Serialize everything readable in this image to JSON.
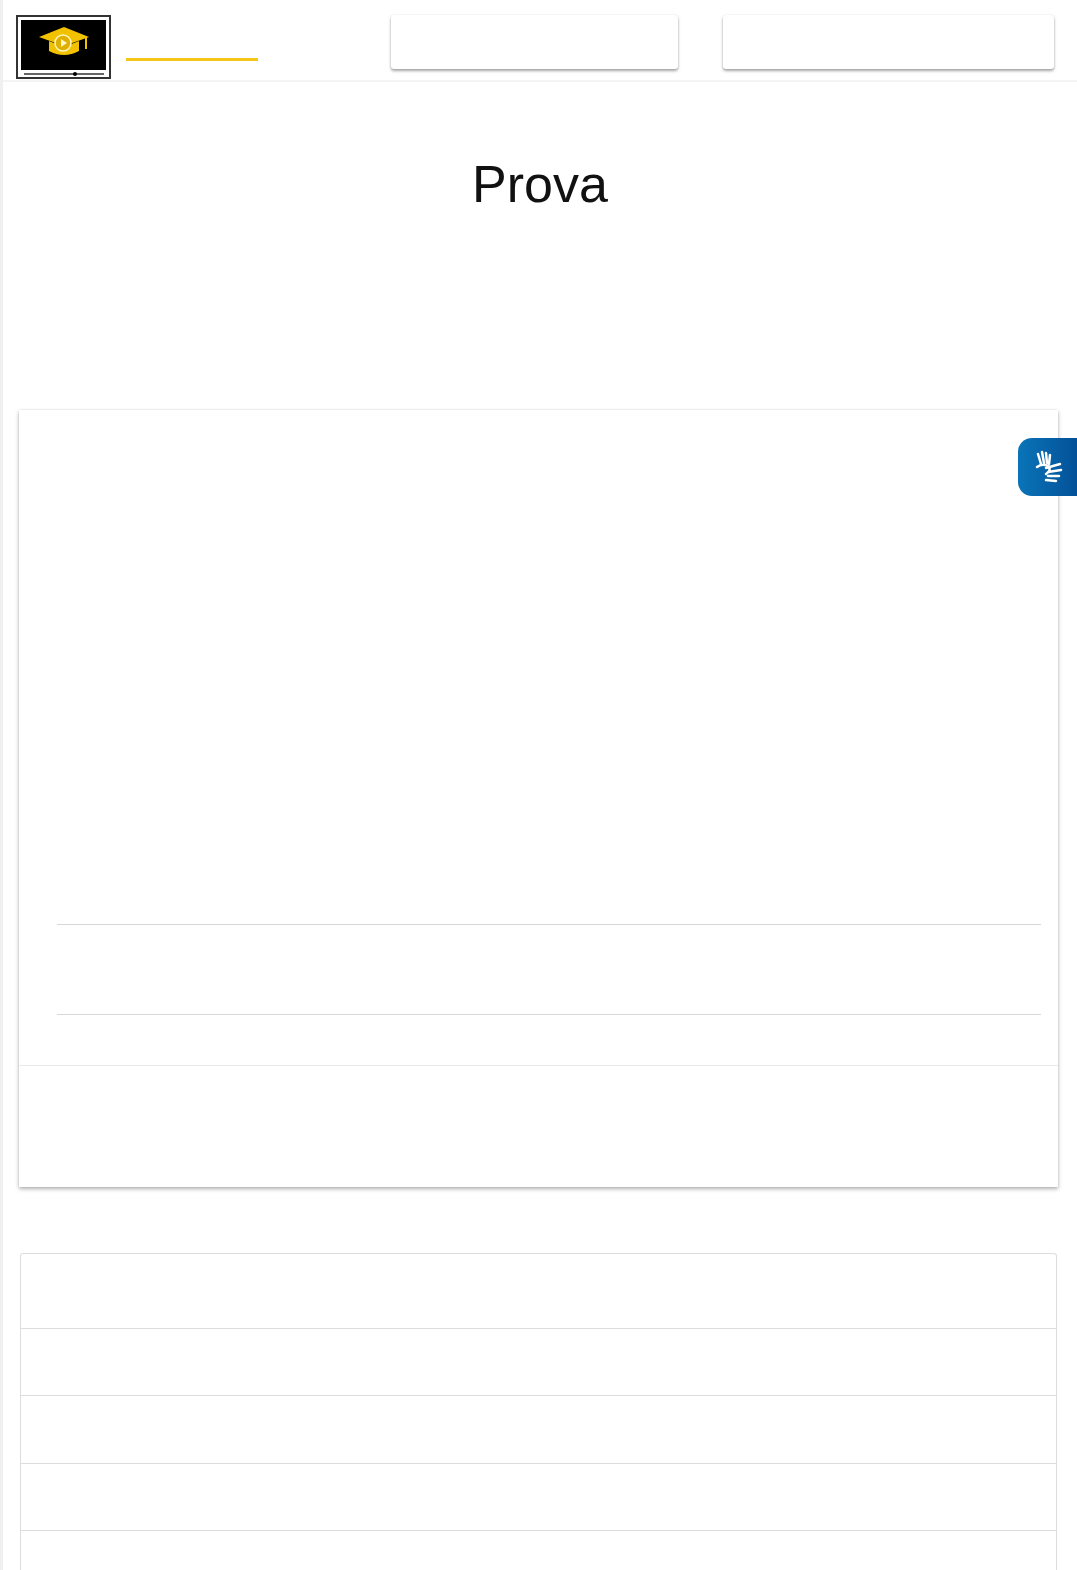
{
  "page": {
    "title": "Prova"
  }
}
